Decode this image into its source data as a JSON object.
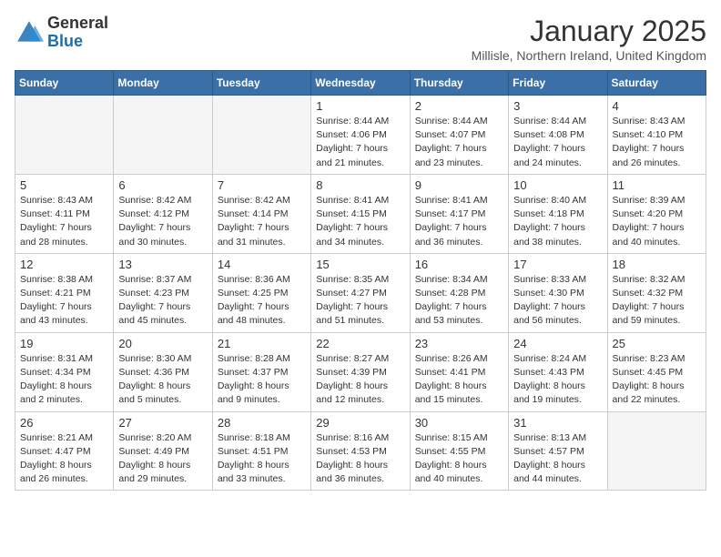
{
  "logo": {
    "general": "General",
    "blue": "Blue"
  },
  "title": "January 2025",
  "location": "Millisle, Northern Ireland, United Kingdom",
  "weekdays": [
    "Sunday",
    "Monday",
    "Tuesday",
    "Wednesday",
    "Thursday",
    "Friday",
    "Saturday"
  ],
  "weeks": [
    [
      {
        "day": "",
        "info": ""
      },
      {
        "day": "",
        "info": ""
      },
      {
        "day": "",
        "info": ""
      },
      {
        "day": "1",
        "info": "Sunrise: 8:44 AM\nSunset: 4:06 PM\nDaylight: 7 hours\nand 21 minutes."
      },
      {
        "day": "2",
        "info": "Sunrise: 8:44 AM\nSunset: 4:07 PM\nDaylight: 7 hours\nand 23 minutes."
      },
      {
        "day": "3",
        "info": "Sunrise: 8:44 AM\nSunset: 4:08 PM\nDaylight: 7 hours\nand 24 minutes."
      },
      {
        "day": "4",
        "info": "Sunrise: 8:43 AM\nSunset: 4:10 PM\nDaylight: 7 hours\nand 26 minutes."
      }
    ],
    [
      {
        "day": "5",
        "info": "Sunrise: 8:43 AM\nSunset: 4:11 PM\nDaylight: 7 hours\nand 28 minutes."
      },
      {
        "day": "6",
        "info": "Sunrise: 8:42 AM\nSunset: 4:12 PM\nDaylight: 7 hours\nand 30 minutes."
      },
      {
        "day": "7",
        "info": "Sunrise: 8:42 AM\nSunset: 4:14 PM\nDaylight: 7 hours\nand 31 minutes."
      },
      {
        "day": "8",
        "info": "Sunrise: 8:41 AM\nSunset: 4:15 PM\nDaylight: 7 hours\nand 34 minutes."
      },
      {
        "day": "9",
        "info": "Sunrise: 8:41 AM\nSunset: 4:17 PM\nDaylight: 7 hours\nand 36 minutes."
      },
      {
        "day": "10",
        "info": "Sunrise: 8:40 AM\nSunset: 4:18 PM\nDaylight: 7 hours\nand 38 minutes."
      },
      {
        "day": "11",
        "info": "Sunrise: 8:39 AM\nSunset: 4:20 PM\nDaylight: 7 hours\nand 40 minutes."
      }
    ],
    [
      {
        "day": "12",
        "info": "Sunrise: 8:38 AM\nSunset: 4:21 PM\nDaylight: 7 hours\nand 43 minutes."
      },
      {
        "day": "13",
        "info": "Sunrise: 8:37 AM\nSunset: 4:23 PM\nDaylight: 7 hours\nand 45 minutes."
      },
      {
        "day": "14",
        "info": "Sunrise: 8:36 AM\nSunset: 4:25 PM\nDaylight: 7 hours\nand 48 minutes."
      },
      {
        "day": "15",
        "info": "Sunrise: 8:35 AM\nSunset: 4:27 PM\nDaylight: 7 hours\nand 51 minutes."
      },
      {
        "day": "16",
        "info": "Sunrise: 8:34 AM\nSunset: 4:28 PM\nDaylight: 7 hours\nand 53 minutes."
      },
      {
        "day": "17",
        "info": "Sunrise: 8:33 AM\nSunset: 4:30 PM\nDaylight: 7 hours\nand 56 minutes."
      },
      {
        "day": "18",
        "info": "Sunrise: 8:32 AM\nSunset: 4:32 PM\nDaylight: 7 hours\nand 59 minutes."
      }
    ],
    [
      {
        "day": "19",
        "info": "Sunrise: 8:31 AM\nSunset: 4:34 PM\nDaylight: 8 hours\nand 2 minutes."
      },
      {
        "day": "20",
        "info": "Sunrise: 8:30 AM\nSunset: 4:36 PM\nDaylight: 8 hours\nand 5 minutes."
      },
      {
        "day": "21",
        "info": "Sunrise: 8:28 AM\nSunset: 4:37 PM\nDaylight: 8 hours\nand 9 minutes."
      },
      {
        "day": "22",
        "info": "Sunrise: 8:27 AM\nSunset: 4:39 PM\nDaylight: 8 hours\nand 12 minutes."
      },
      {
        "day": "23",
        "info": "Sunrise: 8:26 AM\nSunset: 4:41 PM\nDaylight: 8 hours\nand 15 minutes."
      },
      {
        "day": "24",
        "info": "Sunrise: 8:24 AM\nSunset: 4:43 PM\nDaylight: 8 hours\nand 19 minutes."
      },
      {
        "day": "25",
        "info": "Sunrise: 8:23 AM\nSunset: 4:45 PM\nDaylight: 8 hours\nand 22 minutes."
      }
    ],
    [
      {
        "day": "26",
        "info": "Sunrise: 8:21 AM\nSunset: 4:47 PM\nDaylight: 8 hours\nand 26 minutes."
      },
      {
        "day": "27",
        "info": "Sunrise: 8:20 AM\nSunset: 4:49 PM\nDaylight: 8 hours\nand 29 minutes."
      },
      {
        "day": "28",
        "info": "Sunrise: 8:18 AM\nSunset: 4:51 PM\nDaylight: 8 hours\nand 33 minutes."
      },
      {
        "day": "29",
        "info": "Sunrise: 8:16 AM\nSunset: 4:53 PM\nDaylight: 8 hours\nand 36 minutes."
      },
      {
        "day": "30",
        "info": "Sunrise: 8:15 AM\nSunset: 4:55 PM\nDaylight: 8 hours\nand 40 minutes."
      },
      {
        "day": "31",
        "info": "Sunrise: 8:13 AM\nSunset: 4:57 PM\nDaylight: 8 hours\nand 44 minutes."
      },
      {
        "day": "",
        "info": ""
      }
    ]
  ]
}
